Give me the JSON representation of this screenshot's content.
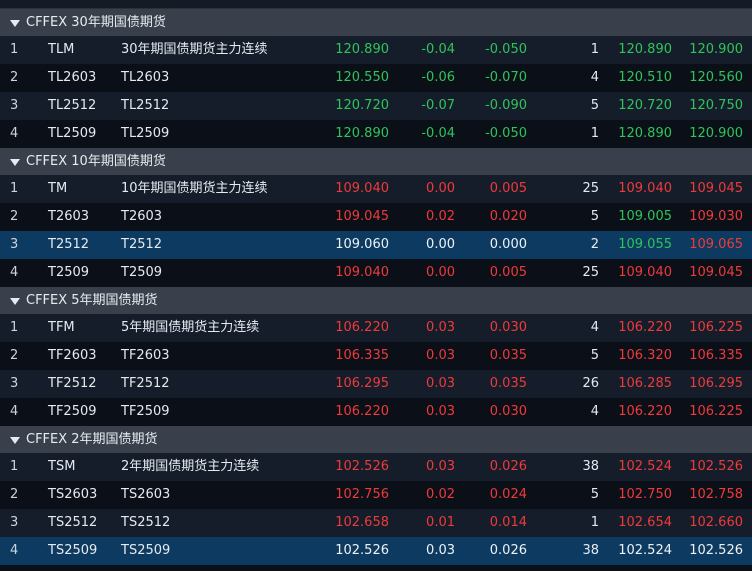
{
  "colors": {
    "up": "#ef3a3a",
    "down": "#2fc45a",
    "neutral": "#eef2f6",
    "selected_row": "#0d3a60",
    "group_header": "#3a404b"
  },
  "groups": [
    {
      "title": "CFFEX 30年期国债期货",
      "icon": "caret-down-icon",
      "rows": [
        {
          "idx": "1",
          "code": "TLM",
          "name": "30年期国债期货主力连续",
          "last": "120.890",
          "chg": "-0.04",
          "pct": "-0.050",
          "vol": "1",
          "bid": "120.890",
          "ask": "120.900",
          "last_c": "green",
          "chg_c": "green",
          "pct_c": "green",
          "bid_c": "green",
          "ask_c": "green",
          "selected": false
        },
        {
          "idx": "2",
          "code": "TL2603",
          "name": "TL2603",
          "last": "120.550",
          "chg": "-0.06",
          "pct": "-0.070",
          "vol": "4",
          "bid": "120.510",
          "ask": "120.560",
          "last_c": "green",
          "chg_c": "green",
          "pct_c": "green",
          "bid_c": "green",
          "ask_c": "green",
          "selected": false
        },
        {
          "idx": "3",
          "code": "TL2512",
          "name": "TL2512",
          "last": "120.720",
          "chg": "-0.07",
          "pct": "-0.090",
          "vol": "5",
          "bid": "120.720",
          "ask": "120.750",
          "last_c": "green",
          "chg_c": "green",
          "pct_c": "green",
          "bid_c": "green",
          "ask_c": "green",
          "selected": false
        },
        {
          "idx": "4",
          "code": "TL2509",
          "name": "TL2509",
          "last": "120.890",
          "chg": "-0.04",
          "pct": "-0.050",
          "vol": "1",
          "bid": "120.890",
          "ask": "120.900",
          "last_c": "green",
          "chg_c": "green",
          "pct_c": "green",
          "bid_c": "green",
          "ask_c": "green",
          "selected": false
        }
      ]
    },
    {
      "title": "CFFEX 10年期国债期货",
      "icon": "caret-down-icon",
      "rows": [
        {
          "idx": "1",
          "code": "TM",
          "name": "10年期国债期货主力连续",
          "last": "109.040",
          "chg": "0.00",
          "pct": "0.005",
          "vol": "25",
          "bid": "109.040",
          "ask": "109.045",
          "last_c": "red",
          "chg_c": "red",
          "pct_c": "red",
          "bid_c": "red",
          "ask_c": "red",
          "selected": false
        },
        {
          "idx": "2",
          "code": "T2603",
          "name": "T2603",
          "last": "109.045",
          "chg": "0.02",
          "pct": "0.020",
          "vol": "5",
          "bid": "109.005",
          "ask": "109.030",
          "last_c": "red",
          "chg_c": "red",
          "pct_c": "red",
          "bid_c": "green",
          "ask_c": "red",
          "selected": false
        },
        {
          "idx": "3",
          "code": "T2512",
          "name": "T2512",
          "last": "109.060",
          "chg": "0.00",
          "pct": "0.000",
          "vol": "2",
          "bid": "109.055",
          "ask": "109.065",
          "last_c": "white",
          "chg_c": "white",
          "pct_c": "white",
          "bid_c": "green",
          "ask_c": "red",
          "selected": true
        },
        {
          "idx": "4",
          "code": "T2509",
          "name": "T2509",
          "last": "109.040",
          "chg": "0.00",
          "pct": "0.005",
          "vol": "25",
          "bid": "109.040",
          "ask": "109.045",
          "last_c": "red",
          "chg_c": "red",
          "pct_c": "red",
          "bid_c": "red",
          "ask_c": "red",
          "selected": false
        }
      ]
    },
    {
      "title": "CFFEX 5年期国债期货",
      "icon": "caret-down-icon",
      "rows": [
        {
          "idx": "1",
          "code": "TFM",
          "name": "5年期国债期货主力连续",
          "last": "106.220",
          "chg": "0.03",
          "pct": "0.030",
          "vol": "4",
          "bid": "106.220",
          "ask": "106.225",
          "last_c": "red",
          "chg_c": "red",
          "pct_c": "red",
          "bid_c": "red",
          "ask_c": "red",
          "selected": false
        },
        {
          "idx": "2",
          "code": "TF2603",
          "name": "TF2603",
          "last": "106.335",
          "chg": "0.03",
          "pct": "0.035",
          "vol": "5",
          "bid": "106.320",
          "ask": "106.335",
          "last_c": "red",
          "chg_c": "red",
          "pct_c": "red",
          "bid_c": "red",
          "ask_c": "red",
          "selected": false
        },
        {
          "idx": "3",
          "code": "TF2512",
          "name": "TF2512",
          "last": "106.295",
          "chg": "0.03",
          "pct": "0.035",
          "vol": "26",
          "bid": "106.285",
          "ask": "106.295",
          "last_c": "red",
          "chg_c": "red",
          "pct_c": "red",
          "bid_c": "red",
          "ask_c": "red",
          "selected": false
        },
        {
          "idx": "4",
          "code": "TF2509",
          "name": "TF2509",
          "last": "106.220",
          "chg": "0.03",
          "pct": "0.030",
          "vol": "4",
          "bid": "106.220",
          "ask": "106.225",
          "last_c": "red",
          "chg_c": "red",
          "pct_c": "red",
          "bid_c": "red",
          "ask_c": "red",
          "selected": false
        }
      ]
    },
    {
      "title": "CFFEX 2年期国债期货",
      "icon": "caret-down-icon",
      "rows": [
        {
          "idx": "1",
          "code": "TSM",
          "name": "2年期国债期货主力连续",
          "last": "102.526",
          "chg": "0.03",
          "pct": "0.026",
          "vol": "38",
          "bid": "102.524",
          "ask": "102.526",
          "last_c": "red",
          "chg_c": "red",
          "pct_c": "red",
          "bid_c": "red",
          "ask_c": "red",
          "selected": false
        },
        {
          "idx": "2",
          "code": "TS2603",
          "name": "TS2603",
          "last": "102.756",
          "chg": "0.02",
          "pct": "0.024",
          "vol": "5",
          "bid": "102.750",
          "ask": "102.758",
          "last_c": "red",
          "chg_c": "red",
          "pct_c": "red",
          "bid_c": "red",
          "ask_c": "red",
          "selected": false
        },
        {
          "idx": "3",
          "code": "TS2512",
          "name": "TS2512",
          "last": "102.658",
          "chg": "0.01",
          "pct": "0.014",
          "vol": "1",
          "bid": "102.654",
          "ask": "102.660",
          "last_c": "red",
          "chg_c": "red",
          "pct_c": "red",
          "bid_c": "red",
          "ask_c": "red",
          "selected": false
        },
        {
          "idx": "4",
          "code": "TS2509",
          "name": "TS2509",
          "last": "102.526",
          "chg": "0.03",
          "pct": "0.026",
          "vol": "38",
          "bid": "102.524",
          "ask": "102.526",
          "last_c": "white",
          "chg_c": "white",
          "pct_c": "white",
          "bid_c": "white",
          "ask_c": "white",
          "selected": true
        }
      ]
    }
  ]
}
